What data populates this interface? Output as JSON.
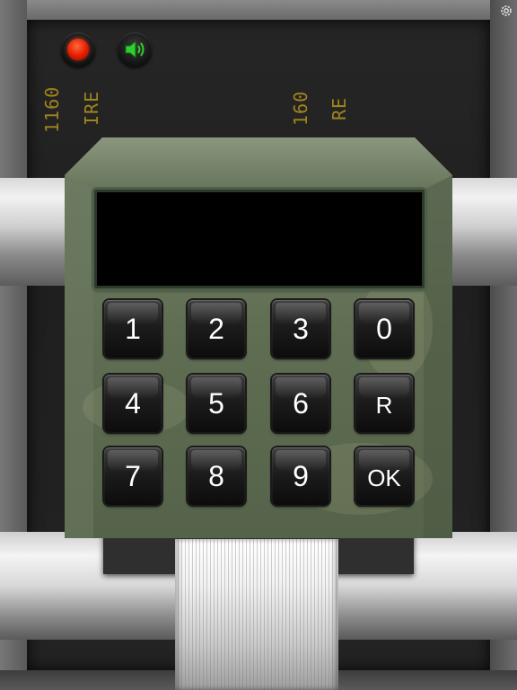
{
  "app": {
    "settings_icon": "gear-icon"
  },
  "top_controls": {
    "record_button_icon": "record-dot-icon",
    "sound_button_icon": "speaker-volume-icon",
    "colors": {
      "record": "#e41a00",
      "sound": "#2fcf2f"
    }
  },
  "readouts": [
    {
      "text": "1160"
    },
    {
      "text": "IRE"
    },
    {
      "text": "160"
    },
    {
      "text": "RE"
    }
  ],
  "keypad": {
    "display_value": "",
    "display_color": "#000000",
    "body_color": "#5f6d52",
    "rows": [
      [
        "1",
        "2",
        "3",
        "0"
      ],
      [
        "4",
        "5",
        "6",
        "R"
      ],
      [
        "7",
        "8",
        "9",
        "OK"
      ]
    ]
  }
}
